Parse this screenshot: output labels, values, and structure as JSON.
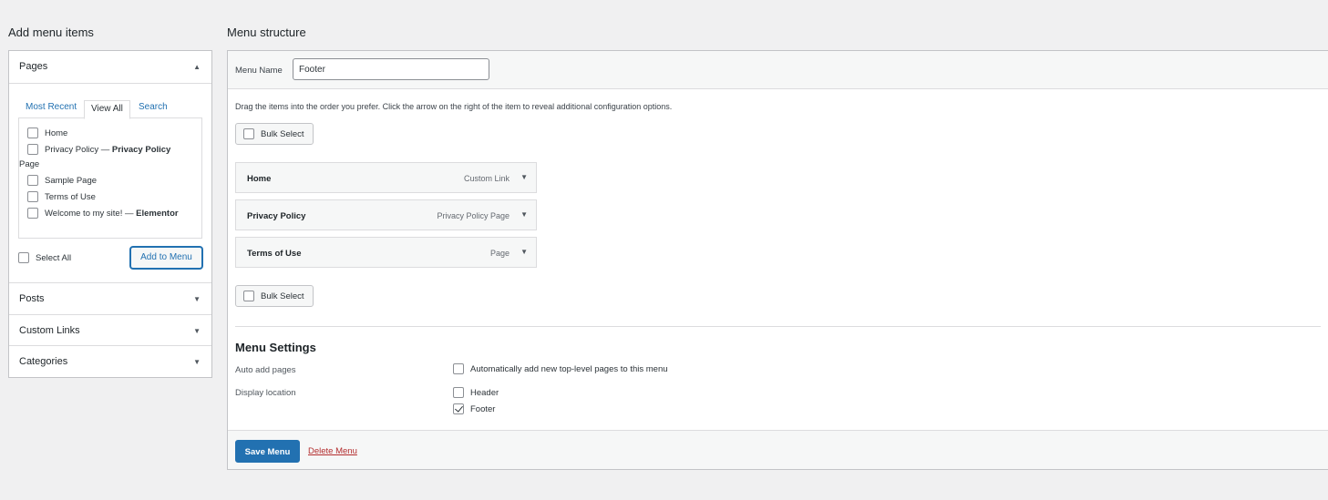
{
  "left": {
    "heading": "Add menu items",
    "pages": {
      "title": "Pages",
      "tabs": [
        "Most Recent",
        "View All",
        "Search"
      ],
      "items": [
        {
          "label": "Home",
          "suffix": ""
        },
        {
          "label": "Privacy Policy — ",
          "suffix": "Privacy Policy",
          "wrap": "Page"
        },
        {
          "label": "Sample Page",
          "suffix": ""
        },
        {
          "label": "Terms of Use",
          "suffix": ""
        },
        {
          "label": "Welcome to my site! — ",
          "suffix": "Elementor"
        }
      ],
      "select_all": "Select All",
      "add_button": "Add to Menu"
    },
    "sections": [
      "Posts",
      "Custom Links",
      "Categories"
    ]
  },
  "right": {
    "heading": "Menu structure",
    "menu_name_label": "Menu Name",
    "menu_name_value": "Footer",
    "instructions": "Drag the items into the order you prefer. Click the arrow on the right of the item to reveal additional configuration options.",
    "bulk_select": "Bulk Select",
    "items": [
      {
        "title": "Home",
        "type": "Custom Link"
      },
      {
        "title": "Privacy Policy",
        "type": "Privacy Policy Page"
      },
      {
        "title": "Terms of Use",
        "type": "Page"
      }
    ],
    "settings": {
      "heading": "Menu Settings",
      "auto_add_label": "Auto add pages",
      "auto_add_option": "Automatically add new top-level pages to this menu",
      "display_location_label": "Display location",
      "locations": [
        {
          "label": "Header",
          "checked": false
        },
        {
          "label": "Footer",
          "checked": true
        }
      ]
    },
    "save_button": "Save Menu",
    "delete_link": "Delete Menu"
  },
  "colors": {
    "accent": "#2271b1",
    "danger": "#b32d2e",
    "background": "#f0f0f1"
  }
}
